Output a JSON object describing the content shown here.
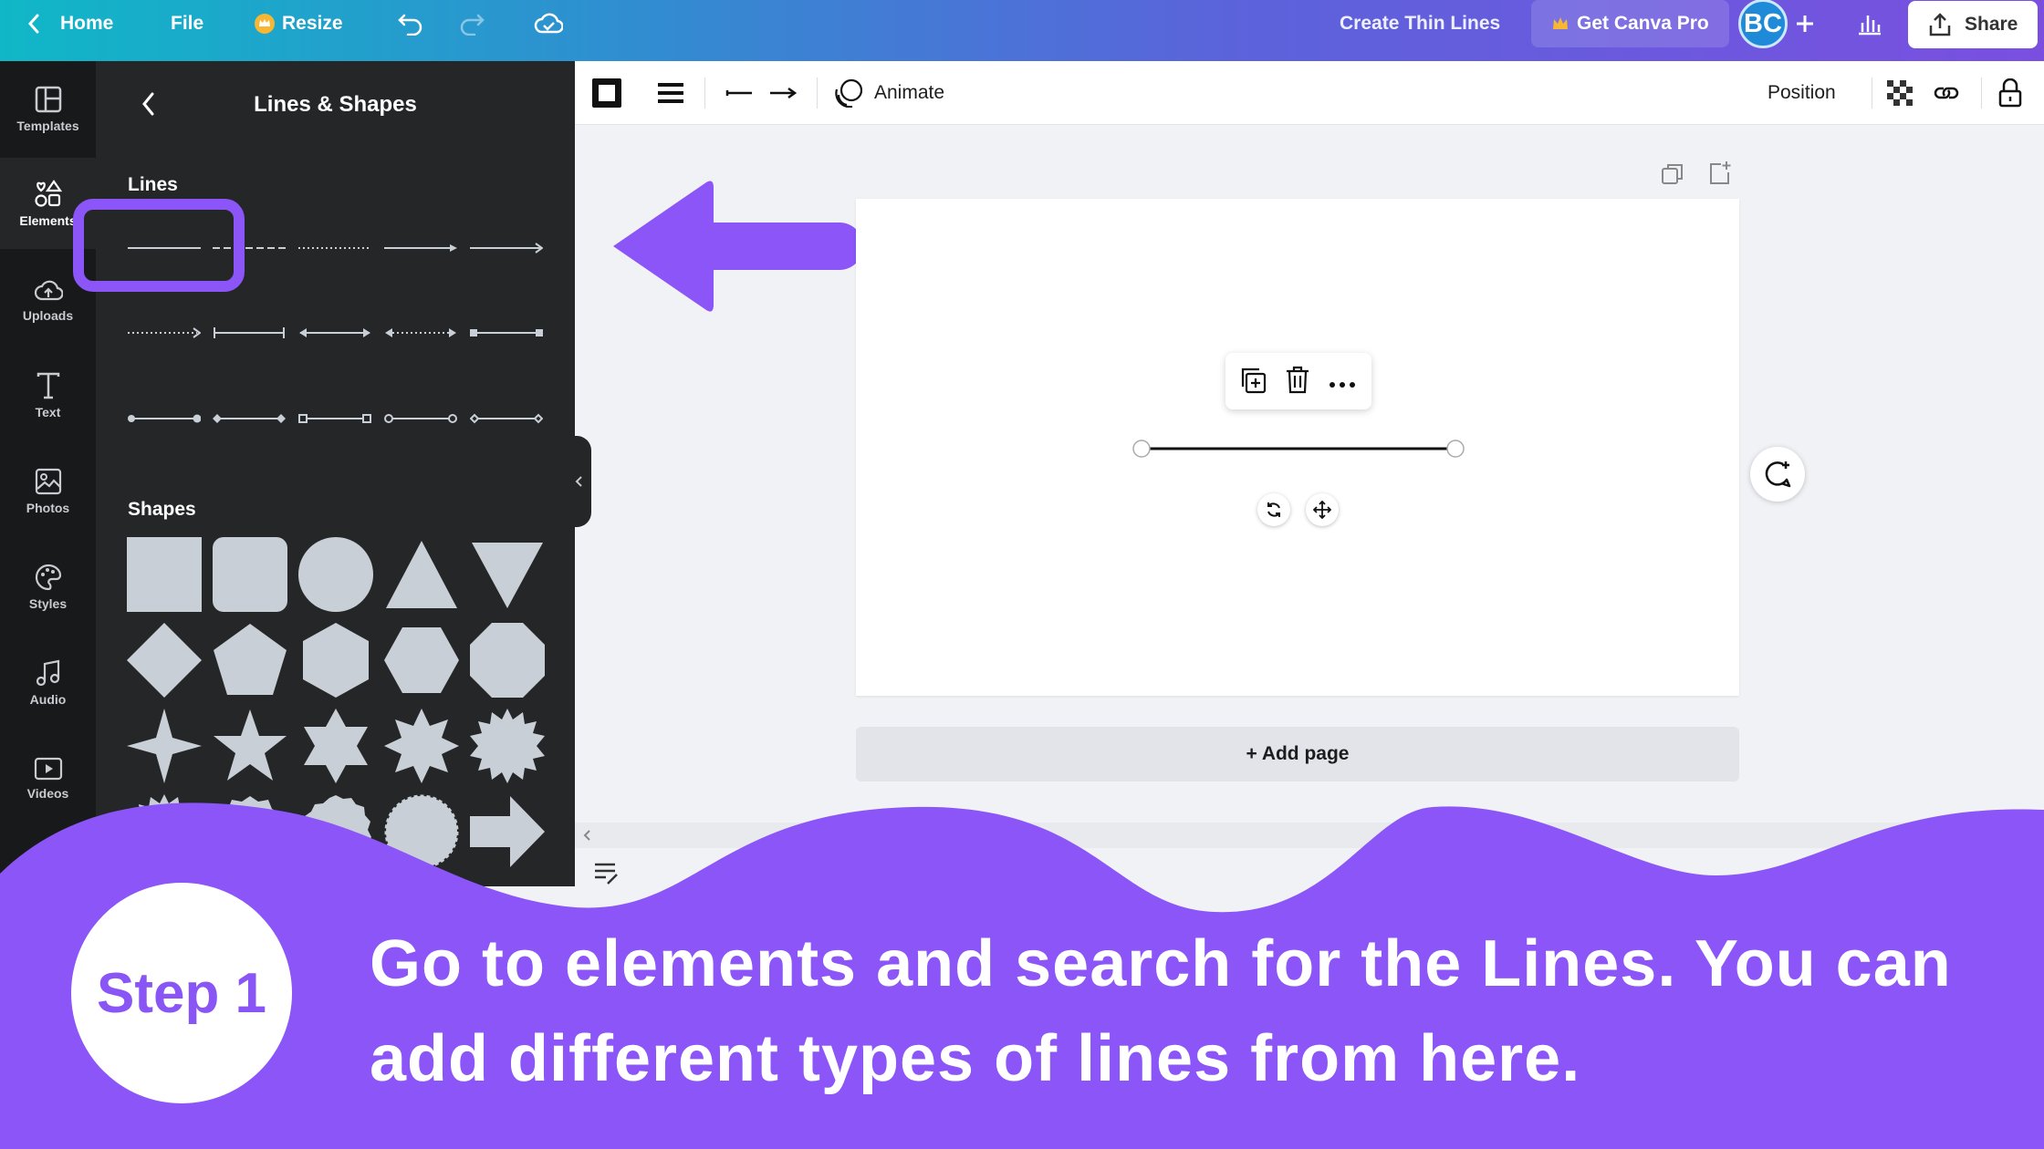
{
  "topbar": {
    "home": "Home",
    "file": "File",
    "resize": "Resize",
    "design_title": "Create Thin Lines",
    "get_pro": "Get Canva Pro",
    "avatar": "BC",
    "share": "Share"
  },
  "rail": {
    "templates": "Templates",
    "elements": "Elements",
    "uploads": "Uploads",
    "text": "Text",
    "photos": "Photos",
    "styles": "Styles",
    "audio": "Audio",
    "videos": "Videos"
  },
  "panel": {
    "title": "Lines & Shapes",
    "lines_heading": "Lines",
    "shapes_heading": "Shapes"
  },
  "toolbar": {
    "animate": "Animate",
    "position": "Position"
  },
  "canvas": {
    "add_page": "+ Add page"
  },
  "overlay": {
    "step_label": "Step 1",
    "caption": "Go to elements and search for the Lines. You can add different types of lines from here."
  },
  "colors": {
    "accent_purple": "#8b55f7",
    "panel_bg": "#252627",
    "swatch_gray": "#c9cfd6"
  }
}
